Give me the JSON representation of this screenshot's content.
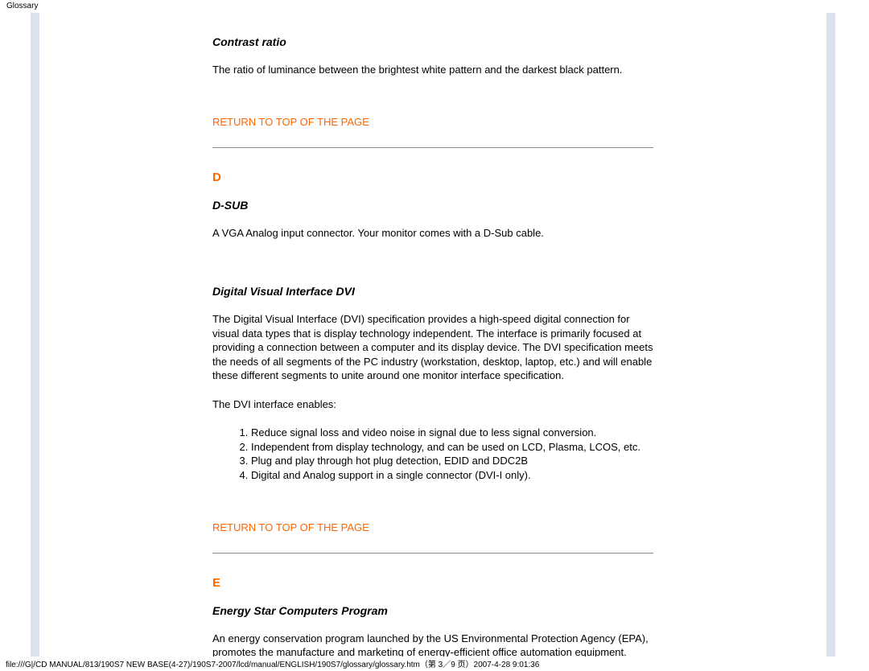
{
  "header": {
    "label": "Glossary"
  },
  "terms": {
    "contrast_ratio": {
      "title": "Contrast ratio",
      "body": "The ratio of luminance between the brightest white pattern and the darkest black pattern."
    },
    "d_sub": {
      "title": "D-SUB",
      "body": "A VGA Analog input connector. Your monitor comes with a D-Sub cable."
    },
    "dvi": {
      "title": "Digital Visual Interface DVI",
      "body": "The Digital Visual Interface (DVI) specification provides a high-speed digital connection for visual data types that is display technology independent. The interface is primarily focused at providing a connection between a computer and its display device. The DVI specification meets the needs of all segments of the PC industry (workstation, desktop, laptop, etc.) and will enable these different segments to unite around one monitor interface specification.",
      "enables_intro": "The DVI interface enables:",
      "enables": [
        "Reduce signal loss and video noise in signal due to less signal conversion.",
        "Independent from display technology, and can be used on LCD, Plasma, LCOS, etc.",
        "Plug and play through hot plug detection, EDID and DDC2B",
        "Digital and Analog support in a single connector (DVI-I only)."
      ]
    },
    "energy_star": {
      "title": "Energy Star Computers Program",
      "body": "An energy conservation program launched by the US Environmental Protection Agency (EPA), promotes the manufacture and marketing of energy-efficient office automation equipment."
    }
  },
  "sections": {
    "d_letter": "D",
    "e_letter": "E"
  },
  "links": {
    "return_top": "RETURN TO TOP OF THE PAGE"
  },
  "footer": {
    "path": "file:///G|/CD MANUAL/813/190S7 NEW BASE(4-27)/190S7-2007/lcd/manual/ENGLISH/190S7/glossary/glossary.htm（第 3／9 页）2007-4-28 9:01:36"
  }
}
